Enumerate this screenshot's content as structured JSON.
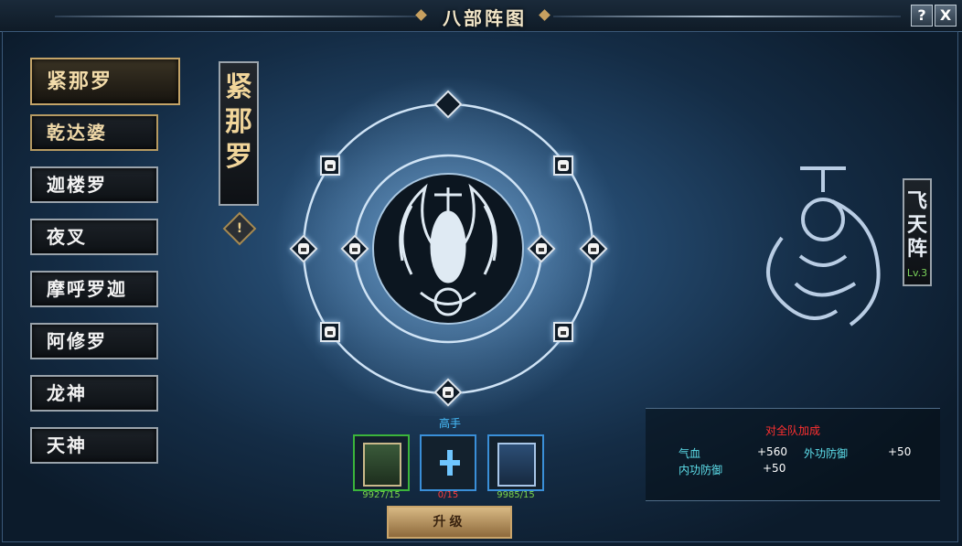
{
  "window": {
    "title": "八部阵图",
    "help_label": "?",
    "close_label": "X"
  },
  "tabs": [
    {
      "label": "紧那罗",
      "state": "selected"
    },
    {
      "label": "乾达婆",
      "state": "highlighted"
    },
    {
      "label": "迦楼罗",
      "state": "normal"
    },
    {
      "label": "夜叉",
      "state": "normal"
    },
    {
      "label": "摩呼罗迦",
      "state": "normal"
    },
    {
      "label": "阿修罗",
      "state": "normal"
    },
    {
      "label": "龙神",
      "state": "normal"
    },
    {
      "label": "天神",
      "state": "normal"
    }
  ],
  "selected_name": {
    "c1": "紧",
    "c2": "那",
    "c3": "罗"
  },
  "warning_icon_label": "!",
  "formation_badge": {
    "c1": "飞",
    "c2": "天",
    "c3": "阵",
    "level": "Lv.3"
  },
  "rank_label": "高手",
  "items": [
    {
      "count": "9927/15",
      "count_color": "#7cd64a",
      "icon": "green-skill-book-icon"
    },
    {
      "count": "0/15",
      "count_color": "#ff3b3b",
      "icon": "plus-icon"
    },
    {
      "count": "9985/15",
      "count_color": "#7cd64a",
      "icon": "blue-skill-book-icon"
    }
  ],
  "upgrade_label": "升级",
  "team_bonus": {
    "title": "对全队加成",
    "stats": [
      {
        "label": "气血",
        "value": "+560"
      },
      {
        "label": "外功防御",
        "value": "+50"
      },
      {
        "label": "内功防御",
        "value": "+50"
      }
    ]
  },
  "colors": {
    "accent_gold": "#c4a468",
    "panel_bg": "#142c45",
    "stat_label": "#5ee0ec",
    "bonus_title": "#ff3030"
  }
}
